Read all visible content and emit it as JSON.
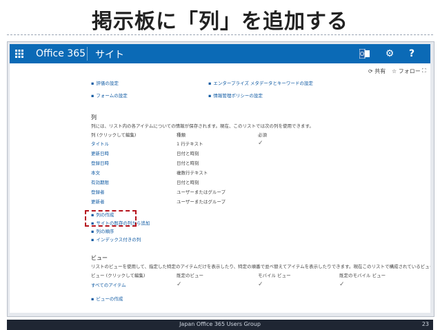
{
  "slide": {
    "title": "掲示板に「列」を追加する",
    "footer": "Japan Office 365 Users Group",
    "page_number": "23"
  },
  "topbar": {
    "brand": "Office 365",
    "site_name": "サイト",
    "icons": [
      "waffle-icon",
      "outlook-icon",
      "gear-icon",
      "help-icon"
    ],
    "help_label": "?"
  },
  "actions": {
    "share": "共有",
    "follow": "フォロー",
    "icons": [
      "share-icon",
      "star-icon",
      "focus-icon"
    ]
  },
  "settings_links": {
    "rating": "評価の設定",
    "form": "フォームの設定",
    "enterprise_metadata": "エンタープライズ メタデータとキーワードの設定",
    "info_policy": "情報管理ポリシーの設定"
  },
  "columns_section": {
    "heading": "列",
    "description": "列には、リスト内の各アイテムについての情報が保存されます。現在、このリストでは次の列を使用できます。",
    "headers": [
      "列 (クリックして編集)",
      "種類",
      "必須"
    ],
    "rows": [
      {
        "name": "タイトル",
        "type": "1 行テキスト",
        "required": true
      },
      {
        "name": "更新日時",
        "type": "日付と時刻",
        "required": false
      },
      {
        "name": "登録日時",
        "type": "日付と時刻",
        "required": false
      },
      {
        "name": "本文",
        "type": "複数行テキスト",
        "required": false
      },
      {
        "name": "有効期限",
        "type": "日付と時刻",
        "required": false
      },
      {
        "name": "登録者",
        "type": "ユーザーまたはグループ",
        "required": false
      },
      {
        "name": "更新者",
        "type": "ユーザーまたはグループ",
        "required": false
      }
    ],
    "links": [
      "列の作成",
      "サイトの既存の列から追加",
      "列の順序",
      "インデックス付きの列"
    ]
  },
  "views_section": {
    "heading": "ビュー",
    "description": "リストのビューを使用して、指定した特定のアイテムだけを表示したり、特定の順番で並べ替えてアイテムを表示したりできます。現在このリストで構成されているビューは次のとおりです。",
    "headers": [
      "ビュー (クリックして編集)",
      "既定のビュー",
      "モバイル ビュー",
      "既定のモバイル ビュー"
    ],
    "rows": [
      {
        "name": "すべてのアイテム",
        "default_view": true,
        "mobile_view": true,
        "default_mobile_view": true
      }
    ],
    "create_link": "ビューの作成"
  },
  "colors": {
    "topbar": "#0b6ab6",
    "link": "#0f5aa3",
    "highlight": "#b5121b",
    "footer": "#1f2633"
  }
}
